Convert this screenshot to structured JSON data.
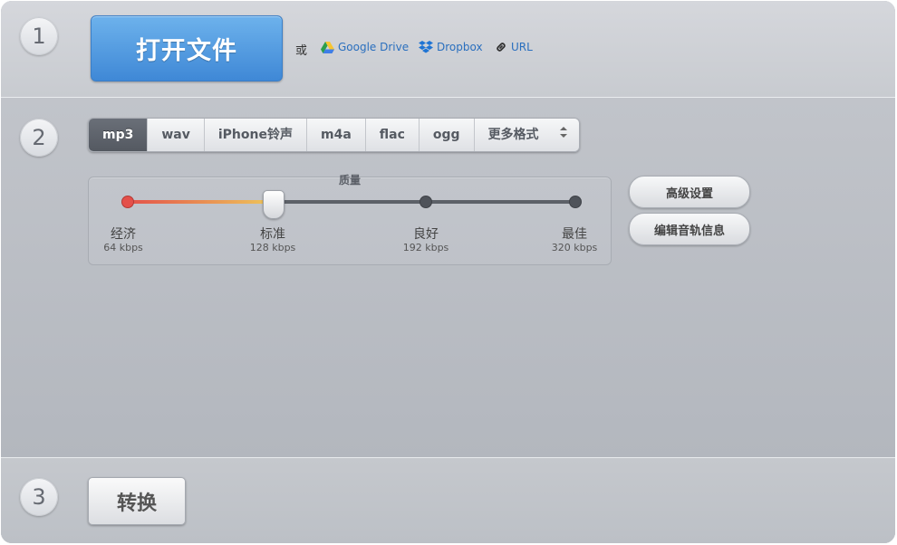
{
  "steps": {
    "one": "1",
    "two": "2",
    "three": "3"
  },
  "open": {
    "button_label": "打开文件",
    "or_text": "或",
    "sources": [
      {
        "label": "Google Drive",
        "icon": "google-drive-icon"
      },
      {
        "label": "Dropbox",
        "icon": "dropbox-icon"
      },
      {
        "label": "URL",
        "icon": "link-icon"
      }
    ]
  },
  "formats": {
    "items": [
      "mp3",
      "wav",
      "iPhone铃声",
      "m4a",
      "flac",
      "ogg"
    ],
    "selected": "mp3",
    "more_label": "更多格式"
  },
  "quality": {
    "label": "质量",
    "selected_level": 1,
    "levels": [
      {
        "name": "经济",
        "rate": "64 kbps"
      },
      {
        "name": "标准",
        "rate": "128 kbps"
      },
      {
        "name": "良好",
        "rate": "192 kbps"
      },
      {
        "name": "最佳",
        "rate": "320 kbps"
      }
    ]
  },
  "actions": {
    "advanced_label": "高级设置",
    "edit_tags_label": "编辑音轨信息",
    "convert_label": "转换"
  },
  "colors": {
    "accent_blue": "#4a92dc",
    "link_blue": "#2a6fbe",
    "slider_low": "#e4504a",
    "slider_mid": "#eec65a"
  }
}
